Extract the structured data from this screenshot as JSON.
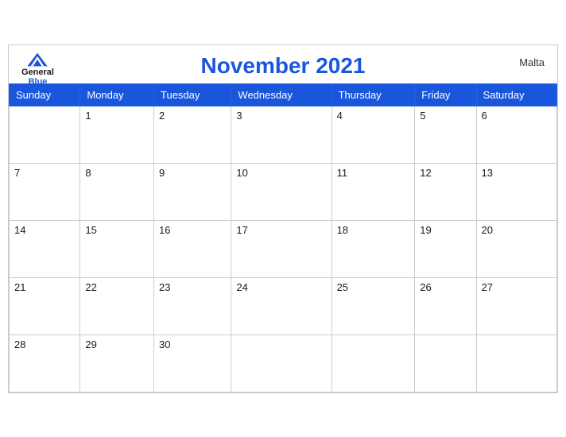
{
  "header": {
    "logo_general": "General",
    "logo_blue": "Blue",
    "title": "November 2021",
    "country": "Malta"
  },
  "weekdays": [
    "Sunday",
    "Monday",
    "Tuesday",
    "Wednesday",
    "Thursday",
    "Friday",
    "Saturday"
  ],
  "weeks": [
    [
      "",
      "1",
      "2",
      "3",
      "4",
      "5",
      "6"
    ],
    [
      "7",
      "8",
      "9",
      "10",
      "11",
      "12",
      "13"
    ],
    [
      "14",
      "15",
      "16",
      "17",
      "18",
      "19",
      "20"
    ],
    [
      "21",
      "22",
      "23",
      "24",
      "25",
      "26",
      "27"
    ],
    [
      "28",
      "29",
      "30",
      "",
      "",
      "",
      ""
    ]
  ]
}
